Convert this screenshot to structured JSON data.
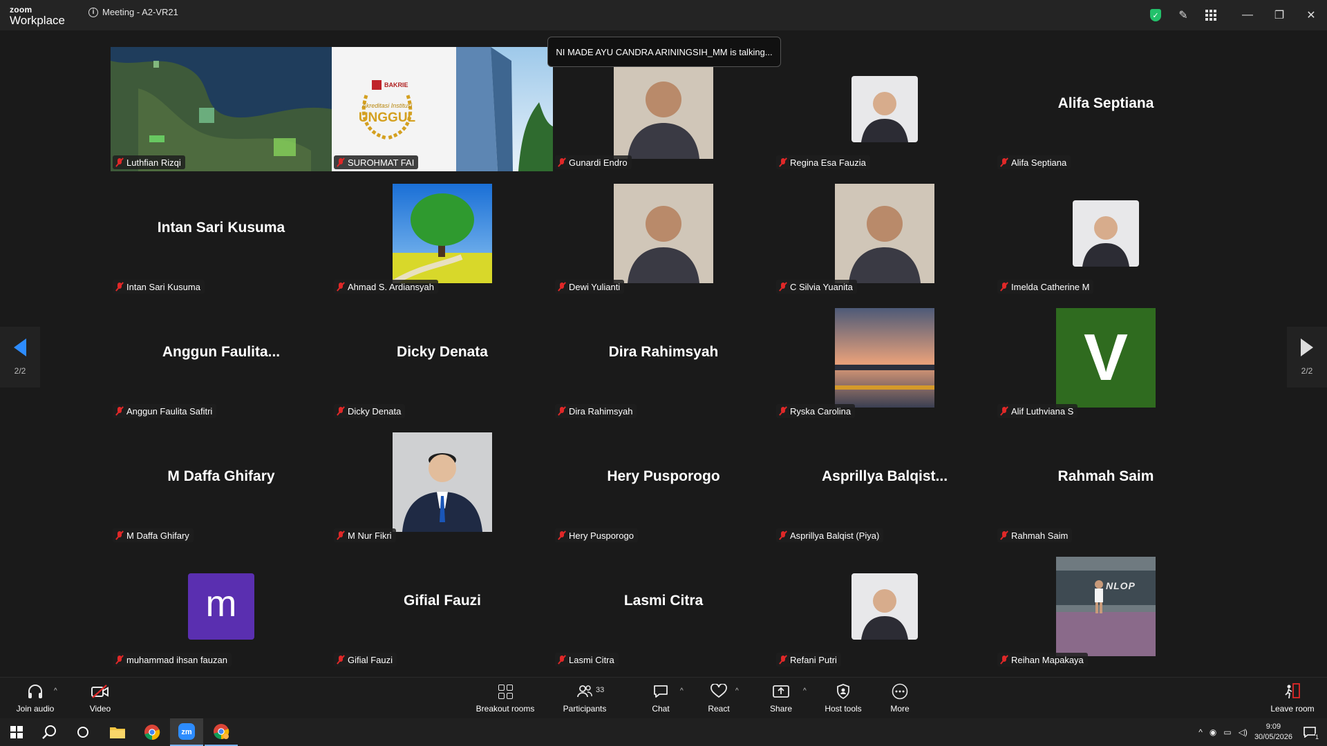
{
  "app": {
    "brand_top": "zoom",
    "brand_bottom": "Workplace",
    "meeting_title": "Meeting - A2-VR21"
  },
  "talking_banner": "NI MADE AYU CANDRA ARININGSIH_MM is talking...",
  "pagination": {
    "left": "2/2",
    "right": "2/2"
  },
  "tiles": [
    {
      "label": "Luthfian Rizqi",
      "display": "",
      "kind": "map"
    },
    {
      "label": "SUROHMAT FAI",
      "display": "",
      "kind": "banner",
      "banner_brand": "BAKRIE",
      "banner_small": "Akreditasi Institusi",
      "banner_big": "UNGGUL"
    },
    {
      "label": "Gunardi Endro",
      "display": "",
      "kind": "photo-big"
    },
    {
      "label": "Regina Esa Fauzia",
      "display": "",
      "kind": "photo"
    },
    {
      "label": "Alifa Septiana",
      "display": "Alifa Septiana",
      "kind": "name"
    },
    {
      "label": "Intan Sari Kusuma",
      "display": "Intan Sari Kusuma",
      "kind": "name"
    },
    {
      "label": "Ahmad S. Ardiansyah",
      "display": "",
      "kind": "tree"
    },
    {
      "label": "Dewi Yulianti",
      "display": "",
      "kind": "photo-big"
    },
    {
      "label": "C Silvia Yuanita",
      "display": "",
      "kind": "photo-big"
    },
    {
      "label": "Imelda Catherine M",
      "display": "",
      "kind": "photo"
    },
    {
      "label": "Anggun Faulita Safitri",
      "display": "Anggun  Faulita...",
      "kind": "name"
    },
    {
      "label": "Dicky Denata",
      "display": "Dicky Denata",
      "kind": "name"
    },
    {
      "label": "Dira Rahimsyah",
      "display": "Dira Rahimsyah",
      "kind": "name"
    },
    {
      "label": "Ryska Carolina",
      "display": "",
      "kind": "sunset"
    },
    {
      "label": "Alif Luthviana S",
      "display": "",
      "kind": "letter",
      "letter": "V",
      "color": "#2f6b1f"
    },
    {
      "label": "M Daffa Ghifary",
      "display": "M Daffa Ghifary",
      "kind": "name"
    },
    {
      "label": "M Nur Fikri",
      "display": "",
      "kind": "suit"
    },
    {
      "label": "Hery Pusporogo",
      "display": "Hery Pusporogo",
      "kind": "name"
    },
    {
      "label": "Asprillya Balqist (Piya)",
      "display": "Asprillya  Balqist...",
      "kind": "name"
    },
    {
      "label": "Rahmah Saim",
      "display": "Rahmah Saim",
      "kind": "name"
    },
    {
      "label": "muhammad ihsan fauzan",
      "display": "",
      "kind": "letter-small",
      "letter": "m",
      "color": "#5a2fb0"
    },
    {
      "label": "Gifial Fauzi",
      "display": "Gifial Fauzi",
      "kind": "name"
    },
    {
      "label": "Lasmi Citra",
      "display": "Lasmi Citra",
      "kind": "name"
    },
    {
      "label": "Refani Putri",
      "display": "",
      "kind": "photo"
    },
    {
      "label": "Reihan Mapakaya",
      "display": "",
      "kind": "tennis",
      "sign": "NLOP"
    }
  ],
  "toolbar": {
    "join_audio": "Join audio",
    "video": "Video",
    "breakout_rooms": "Breakout rooms",
    "participants": "Participants",
    "participants_count": "33",
    "chat": "Chat",
    "react": "React",
    "share": "Share",
    "host_tools": "Host tools",
    "more": "More",
    "leave_room": "Leave room"
  },
  "taskbar": {
    "time": "9:09",
    "date": "30/05/2026",
    "notif_count": "1"
  },
  "colors": {
    "accent": "#2d8cff",
    "muted_mic": "#e02828",
    "shield": "#23c16b"
  }
}
